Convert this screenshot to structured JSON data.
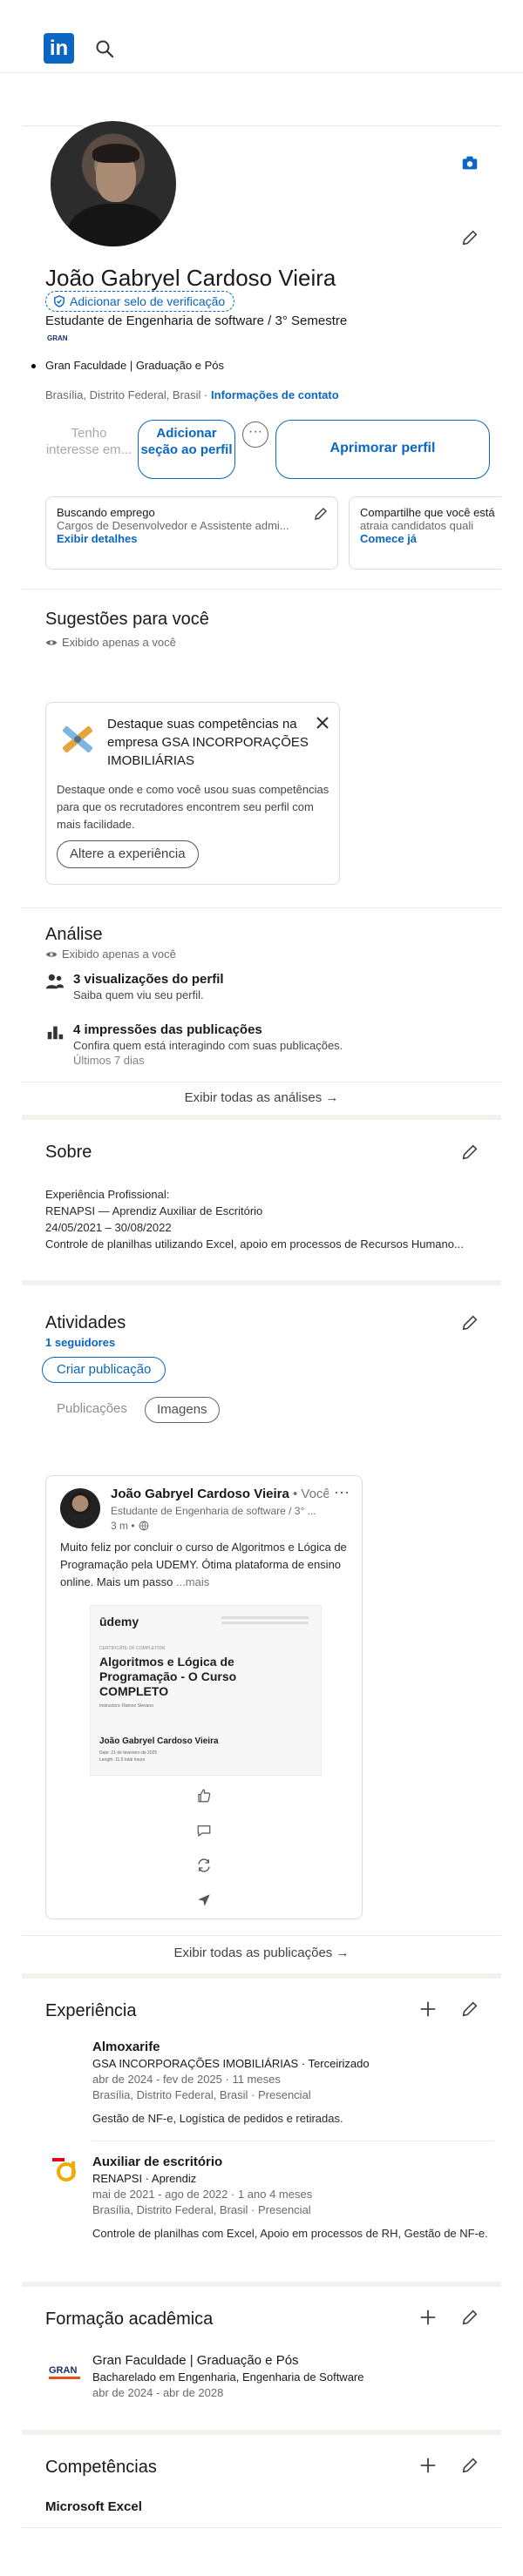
{
  "colors": {
    "accent": "#0a66c2",
    "brand": "#0a66c2"
  },
  "header": {
    "logo_text": "in",
    "search_icon": "search-icon"
  },
  "profile": {
    "name": "João Gabryel Cardoso Vieira",
    "verify_label": "Adicionar selo de verificação",
    "headline": "Estudante de Engenharia de software / 3° Semestre",
    "company_logo_text": "GRAN",
    "education": "Gran Faculdade | Graduação e Pós",
    "location": "Brasília, Distrito Federal, Brasil ·",
    "contact_link": "Informações de contato",
    "buttons": {
      "open_to": "Tenho interesse em...",
      "add_section": "Adicionar seção ao perfil",
      "more": "···",
      "enhance": "Aprimorar perfil"
    },
    "cards": [
      {
        "title": "Buscando emprego",
        "subtitle": "Cargos de Desenvolvedor e Assistente admi...",
        "link": "Exibir detalhes"
      },
      {
        "title": "Compartilhe que você está",
        "subtitle": "atraia candidatos quali",
        "link": "Comece já"
      }
    ]
  },
  "suggestions": {
    "title": "Sugestões para você",
    "private_label": "Exibido apenas a você",
    "card_title": "Destaque suas competências na empresa GSA INCORPORAÇÕES IMOBILIÁRIAS",
    "card_body": "Destaque onde e como você usou suas competências para que os recrutadores encontrem seu perfil com mais facilidade.",
    "card_button": "Altere a experiência"
  },
  "analytics": {
    "title": "Análise",
    "private_label": "Exibido apenas a você",
    "items": [
      {
        "title": "3 visualizações do perfil",
        "subtitle": "Saiba quem viu seu perfil.",
        "extra": ""
      },
      {
        "title": "4 impressões das publicações",
        "subtitle": "Confira quem está interagindo com suas publicações.",
        "extra": "Últimos 7 dias"
      }
    ],
    "show_all": "Exibir todas as análises →"
  },
  "about": {
    "title": "Sobre",
    "lines": [
      "Experiência Profissional:",
      "RENAPSI — Aprendiz Auxiliar de Escritório",
      "24/05/2021 – 30/08/2022",
      "Controle de planilhas utilizando Excel, apoio em processos de Recursos Humano..."
    ]
  },
  "activity": {
    "title": "Atividades",
    "followers": "1 seguidores",
    "create_post": "Criar publicação",
    "tabs": [
      "Publicações",
      "Imagens"
    ],
    "post": {
      "author": "João Gabryel Cardoso Vieira",
      "author_suffix": "• Você",
      "author_headline": "Estudante de Engenharia de software / 3° ...",
      "time": "3 m •",
      "text": "Muito feliz por concluir o curso de Algoritmos e Lógica de Programação pela UDEMY. Ótima plataforma de ensino online. Mais um passo",
      "more": "...mais",
      "certificate": {
        "brand": "ūdemy",
        "label": "CERTIFICATE OF COMPLETION",
        "course": "Algoritmos e Lógica de Programação - O Curso COMPLETO",
        "instructor": "Instructors: Ramon Stevano",
        "student": "João Gabryel Cardoso Vieira",
        "date": "Date: 21 de fevereiro de 2025",
        "length": "Length: 11.5 total hours"
      }
    },
    "show_all": "Exibir todas as publicações →"
  },
  "experience": {
    "title": "Experiência",
    "items": [
      {
        "title": "Almoxarife",
        "company": "GSA INCORPORAÇÕES IMOBILIÁRIAS · Terceirizado",
        "dates": "abr de 2024 - fev de 2025 · 11 meses",
        "location": "Brasília, Distrito Federal, Brasil · Presencial",
        "description": "Gestão de NF-e, Logística de pedidos e retiradas."
      },
      {
        "title": "Auxiliar de escritório",
        "company": "RENAPSI · Aprendiz",
        "dates": "mai de 2021 - ago de 2022 · 1 ano 4 meses",
        "location": "Brasília, Distrito Federal, Brasil · Presencial",
        "description": "Controle de planilhas com Excel, Apoio em processos de RH, Gestão de NF-e."
      }
    ]
  },
  "education": {
    "title": "Formação acadêmica",
    "logo_text": "GRAN",
    "school": "Gran Faculdade | Graduação e Pós",
    "degree": "Bacharelado em Engenharia, Engenharia de Software",
    "dates": "abr de 2024 - abr de 2028"
  },
  "skills": {
    "title": "Competências",
    "items": [
      "Microsoft Excel"
    ]
  }
}
